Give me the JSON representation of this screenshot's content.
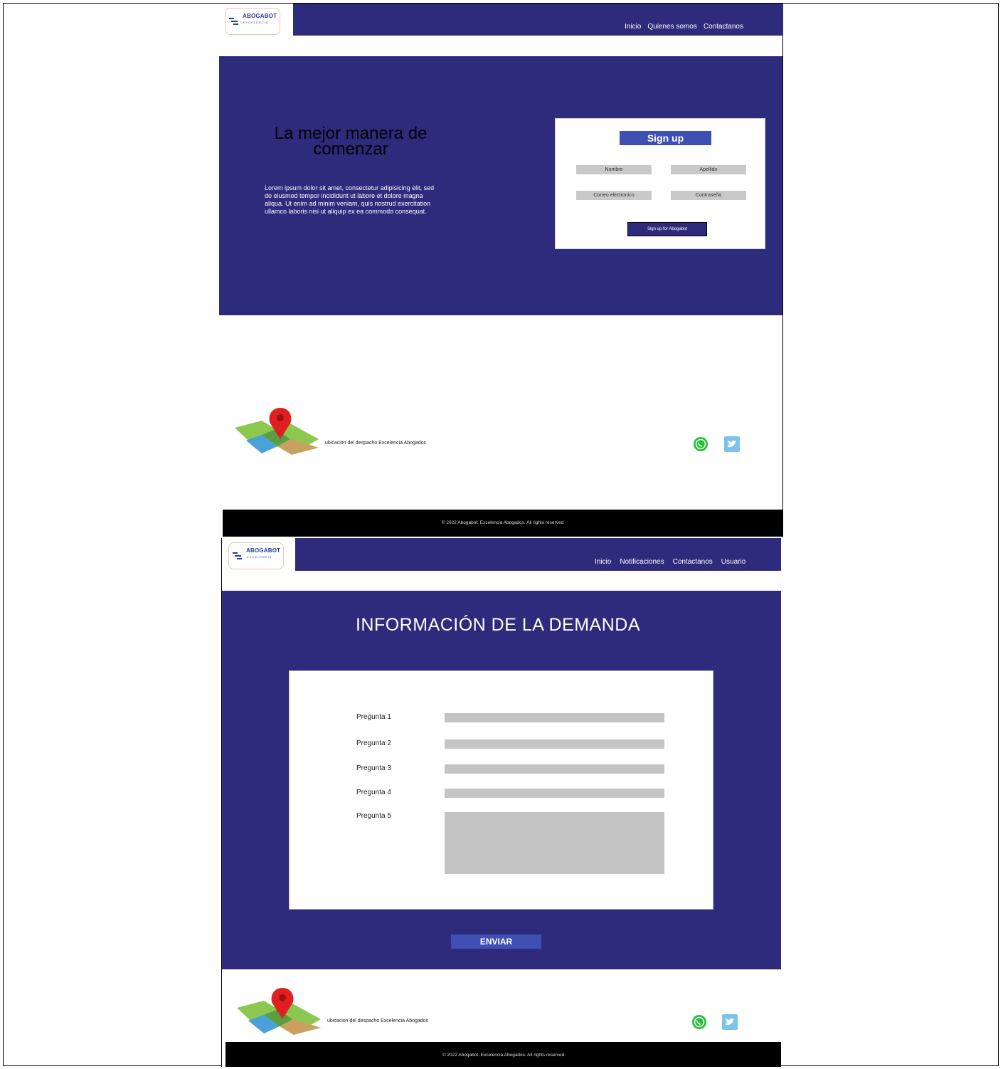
{
  "brand": {
    "name": "ABOGABOT",
    "tagline": "EXCELENCIA"
  },
  "screen1": {
    "nav": [
      "Inicio",
      "Quienes somos",
      "Contactanos"
    ],
    "hero_title": "La mejor manera de comenzar",
    "hero_text": "Lorem ipsum dolor sit amet, consectetur adipisicing elit, sed do eiusmod tempor incididunt ut labore et dolore magna aliqua. Ut enim ad minim veniam, quis nostrud exercitation ullamco laboris nisi ut aliquip ex ea commodo consequat.",
    "signup": {
      "title": "Sign up",
      "fields": [
        "Nombre",
        "Apellido",
        "Correo electronico",
        "Contraseña"
      ],
      "submit": "Sign up for Abogabot"
    },
    "location_text": "ubicacion del despacho Excelencia Abogados",
    "copyright": "© 2022 Abogabot. Excelencia Abogados. All rights reserved"
  },
  "screen2": {
    "nav": [
      "Inicio",
      "Notificaciones",
      "Contactanos",
      "Usuario"
    ],
    "heading": "INFORMACIÓN DE LA DEMANDA",
    "questions": [
      "Pregunta 1",
      "Pregunta 2",
      "Pregunta 3",
      "Pregunta 4",
      "Pregunta 5"
    ],
    "submit": "ENVIAR",
    "location_text": "ubicacion del despacho Excelencia Abogados",
    "copyright": "© 2022 Abogabot. Excelencia Abogados. All rights reserved"
  },
  "colors": {
    "navy": "#2e2a7c",
    "button_blue": "#3f50b5",
    "input_gray": "#c4c4c4"
  },
  "icons": [
    "map-location-icon",
    "whatsapp-icon",
    "twitter-icon"
  ]
}
